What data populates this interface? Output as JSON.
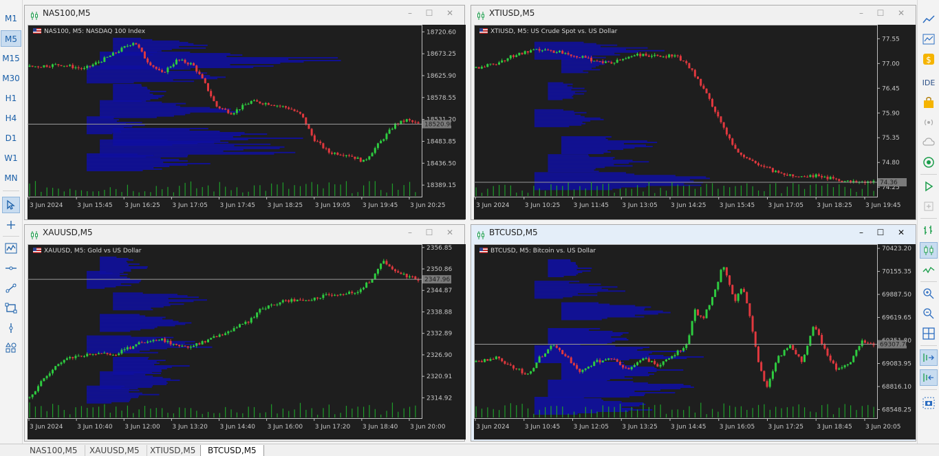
{
  "timeframes": [
    "M1",
    "M5",
    "M15",
    "M30",
    "H1",
    "H4",
    "D1",
    "W1",
    "MN"
  ],
  "active_timeframe": "M5",
  "left_tools": [
    "zig-zag-icon",
    "crosshair-icon",
    "line-chart-tool-icon",
    "horizontal-line-icon",
    "trendline-icon",
    "rectangle-icon",
    "vertical-line-icon",
    "shapes-icon"
  ],
  "right_toolbar": {
    "ide_label": "IDE"
  },
  "tabs": [
    "NAS100,M5",
    "XAUUSD,M5",
    "XTIUSD,M5",
    "BTCUSD,M5"
  ],
  "active_tab": 3,
  "colors": {
    "bull": "#2ecc40",
    "bear": "#e0383e",
    "profile": "#1010a0",
    "chart_bg": "#1e1e1e",
    "grid_text": "#c8c8c8",
    "volume": "#1f9e2a"
  },
  "windows": [
    {
      "title": "NAS100,M5",
      "label": "NAS100, M5:  NASDAQ 100 Index",
      "active": false,
      "chart_data": {
        "type": "candlestick",
        "symbol": "NAS100",
        "timeframe": "M5",
        "ylim": [
          18370,
          18730
        ],
        "y_ticks": [
          "18720.60",
          "18673.25",
          "18625.90",
          "18578.55",
          "18531.20",
          "18483.85",
          "18436.50",
          "18389.15"
        ],
        "x_ticks": [
          "3 Jun 2024",
          "3 Jun 15:45",
          "3 Jun 16:25",
          "3 Jun 17:05",
          "3 Jun 17:45",
          "3 Jun 18:25",
          "3 Jun 19:05",
          "3 Jun 19:45",
          "3 Jun 20:25"
        ],
        "current_price": "18520.90",
        "price_path": [
          [
            0,
            18645
          ],
          [
            0.08,
            18650
          ],
          [
            0.14,
            18640
          ],
          [
            0.2,
            18665
          ],
          [
            0.27,
            18700
          ],
          [
            0.3,
            18660
          ],
          [
            0.34,
            18630
          ],
          [
            0.38,
            18660
          ],
          [
            0.42,
            18650
          ],
          [
            0.45,
            18610
          ],
          [
            0.48,
            18560
          ],
          [
            0.52,
            18545
          ],
          [
            0.57,
            18570
          ],
          [
            0.62,
            18565
          ],
          [
            0.67,
            18555
          ],
          [
            0.7,
            18540
          ],
          [
            0.73,
            18490
          ],
          [
            0.77,
            18460
          ],
          [
            0.82,
            18455
          ],
          [
            0.86,
            18440
          ],
          [
            0.9,
            18480
          ],
          [
            0.94,
            18520
          ],
          [
            0.97,
            18530
          ],
          [
            1,
            18521
          ]
        ],
        "profile": [
          [
            18440,
            0.26
          ],
          [
            18470,
            0.46
          ],
          [
            18495,
            0.38
          ],
          [
            18520,
            0.12
          ],
          [
            18555,
            0.3
          ],
          [
            18590,
            0.12
          ],
          [
            18630,
            0.34
          ],
          [
            18660,
            0.5
          ],
          [
            18690,
            0.2
          ]
        ]
      }
    },
    {
      "title": "XTIUSD,M5",
      "label": "XTIUSD, M5:  US Crude Spot vs. US Dollar",
      "active": false,
      "chart_data": {
        "type": "candlestick",
        "symbol": "XTIUSD",
        "timeframe": "M5",
        "ylim": [
          74.1,
          77.8
        ],
        "y_ticks": [
          "77.55",
          "77.00",
          "76.45",
          "75.90",
          "75.35",
          "74.80",
          "74.25"
        ],
        "x_ticks": [
          "3 Jun 2024",
          "3 Jun 10:25",
          "3 Jun 11:45",
          "3 Jun 13:05",
          "3 Jun 14:25",
          "3 Jun 15:45",
          "3 Jun 17:05",
          "3 Jun 18:25",
          "3 Jun 19:45"
        ],
        "current_price": "74.36",
        "price_path": [
          [
            0,
            76.9
          ],
          [
            0.05,
            77.0
          ],
          [
            0.1,
            77.2
          ],
          [
            0.16,
            77.3
          ],
          [
            0.22,
            77.25
          ],
          [
            0.28,
            77.1
          ],
          [
            0.34,
            77.0
          ],
          [
            0.4,
            77.2
          ],
          [
            0.46,
            77.15
          ],
          [
            0.5,
            77.2
          ],
          [
            0.54,
            76.9
          ],
          [
            0.58,
            76.3
          ],
          [
            0.62,
            75.6
          ],
          [
            0.66,
            75.0
          ],
          [
            0.7,
            74.8
          ],
          [
            0.75,
            74.6
          ],
          [
            0.8,
            74.5
          ],
          [
            0.86,
            74.5
          ],
          [
            0.92,
            74.4
          ],
          [
            1,
            74.36
          ]
        ],
        "profile": [
          [
            74.4,
            0.4
          ],
          [
            74.8,
            0.2
          ],
          [
            75.2,
            0.2
          ],
          [
            75.8,
            0.15
          ],
          [
            76.4,
            0.08
          ],
          [
            77.0,
            0.12
          ],
          [
            77.3,
            0.25
          ]
        ]
      }
    },
    {
      "title": "XAUUSD,M5",
      "label": "XAUUSD, M5:  Gold vs US Dollar",
      "active": false,
      "chart_data": {
        "type": "candlestick",
        "symbol": "XAUUSD",
        "timeframe": "M5",
        "ylim": [
          2310,
          2357
        ],
        "y_ticks": [
          "2356.85",
          "2350.86",
          "2344.87",
          "2338.88",
          "2332.89",
          "2326.90",
          "2320.91",
          "2314.92"
        ],
        "x_ticks": [
          "3 Jun 2024",
          "3 Jun 10:40",
          "3 Jun 12:00",
          "3 Jun 13:20",
          "3 Jun 14:40",
          "3 Jun 16:00",
          "3 Jun 17:20",
          "3 Jun 18:40",
          "3 Jun 20:00"
        ],
        "current_price": "2347.96",
        "price_path": [
          [
            0,
            2315
          ],
          [
            0.05,
            2322
          ],
          [
            0.1,
            2326
          ],
          [
            0.16,
            2327
          ],
          [
            0.22,
            2327
          ],
          [
            0.28,
            2330
          ],
          [
            0.34,
            2331
          ],
          [
            0.4,
            2329
          ],
          [
            0.46,
            2331
          ],
          [
            0.52,
            2334
          ],
          [
            0.56,
            2336
          ],
          [
            0.6,
            2340
          ],
          [
            0.66,
            2342
          ],
          [
            0.72,
            2342
          ],
          [
            0.78,
            2344
          ],
          [
            0.84,
            2344
          ],
          [
            0.88,
            2348
          ],
          [
            0.91,
            2353
          ],
          [
            0.94,
            2350
          ],
          [
            0.97,
            2349
          ],
          [
            1,
            2348
          ]
        ],
        "profile": [
          [
            2316,
            0.15
          ],
          [
            2320,
            0.2
          ],
          [
            2324,
            0.15
          ],
          [
            2330,
            0.3
          ],
          [
            2336,
            0.18
          ],
          [
            2342,
            0.2
          ],
          [
            2348,
            0.12
          ],
          [
            2352,
            0.1
          ]
        ]
      }
    },
    {
      "title": "BTCUSD,M5",
      "label": "BTCUSD, M5:  Bitcoin vs. US Dollar",
      "active": true,
      "chart_data": {
        "type": "candlestick",
        "symbol": "BTCUSD",
        "timeframe": "M5",
        "ylim": [
          68480,
          70440
        ],
        "y_ticks": [
          "70423.20",
          "70155.35",
          "69887.50",
          "69619.65",
          "69351.80",
          "69083.95",
          "68816.10",
          "68548.25"
        ],
        "x_ticks": [
          "3 Jun 2024",
          "3 Jun 10:45",
          "3 Jun 12:05",
          "3 Jun 13:25",
          "3 Jun 14:45",
          "3 Jun 16:05",
          "3 Jun 17:25",
          "3 Jun 18:45",
          "3 Jun 20:05"
        ],
        "current_price": "69307.70",
        "price_path": [
          [
            0,
            69100
          ],
          [
            0.05,
            69150
          ],
          [
            0.09,
            69050
          ],
          [
            0.13,
            68950
          ],
          [
            0.16,
            69150
          ],
          [
            0.19,
            69300
          ],
          [
            0.22,
            69200
          ],
          [
            0.26,
            69000
          ],
          [
            0.3,
            69100
          ],
          [
            0.34,
            69150
          ],
          [
            0.38,
            69000
          ],
          [
            0.42,
            69150
          ],
          [
            0.46,
            69050
          ],
          [
            0.5,
            69200
          ],
          [
            0.53,
            69300
          ],
          [
            0.55,
            69700
          ],
          [
            0.57,
            69600
          ],
          [
            0.6,
            69900
          ],
          [
            0.62,
            70250
          ],
          [
            0.65,
            69800
          ],
          [
            0.67,
            70000
          ],
          [
            0.69,
            69600
          ],
          [
            0.71,
            69100
          ],
          [
            0.73,
            68800
          ],
          [
            0.76,
            69150
          ],
          [
            0.79,
            69300
          ],
          [
            0.82,
            69100
          ],
          [
            0.85,
            69550
          ],
          [
            0.88,
            69200
          ],
          [
            0.91,
            69000
          ],
          [
            0.94,
            69100
          ],
          [
            0.97,
            69350
          ],
          [
            1,
            69308
          ]
        ],
        "profile": [
          [
            68600,
            0.3
          ],
          [
            68800,
            0.32
          ],
          [
            69000,
            0.25
          ],
          [
            69200,
            0.35
          ],
          [
            69400,
            0.2
          ],
          [
            69700,
            0.22
          ],
          [
            69950,
            0.18
          ],
          [
            70200,
            0.1
          ]
        ]
      }
    }
  ]
}
